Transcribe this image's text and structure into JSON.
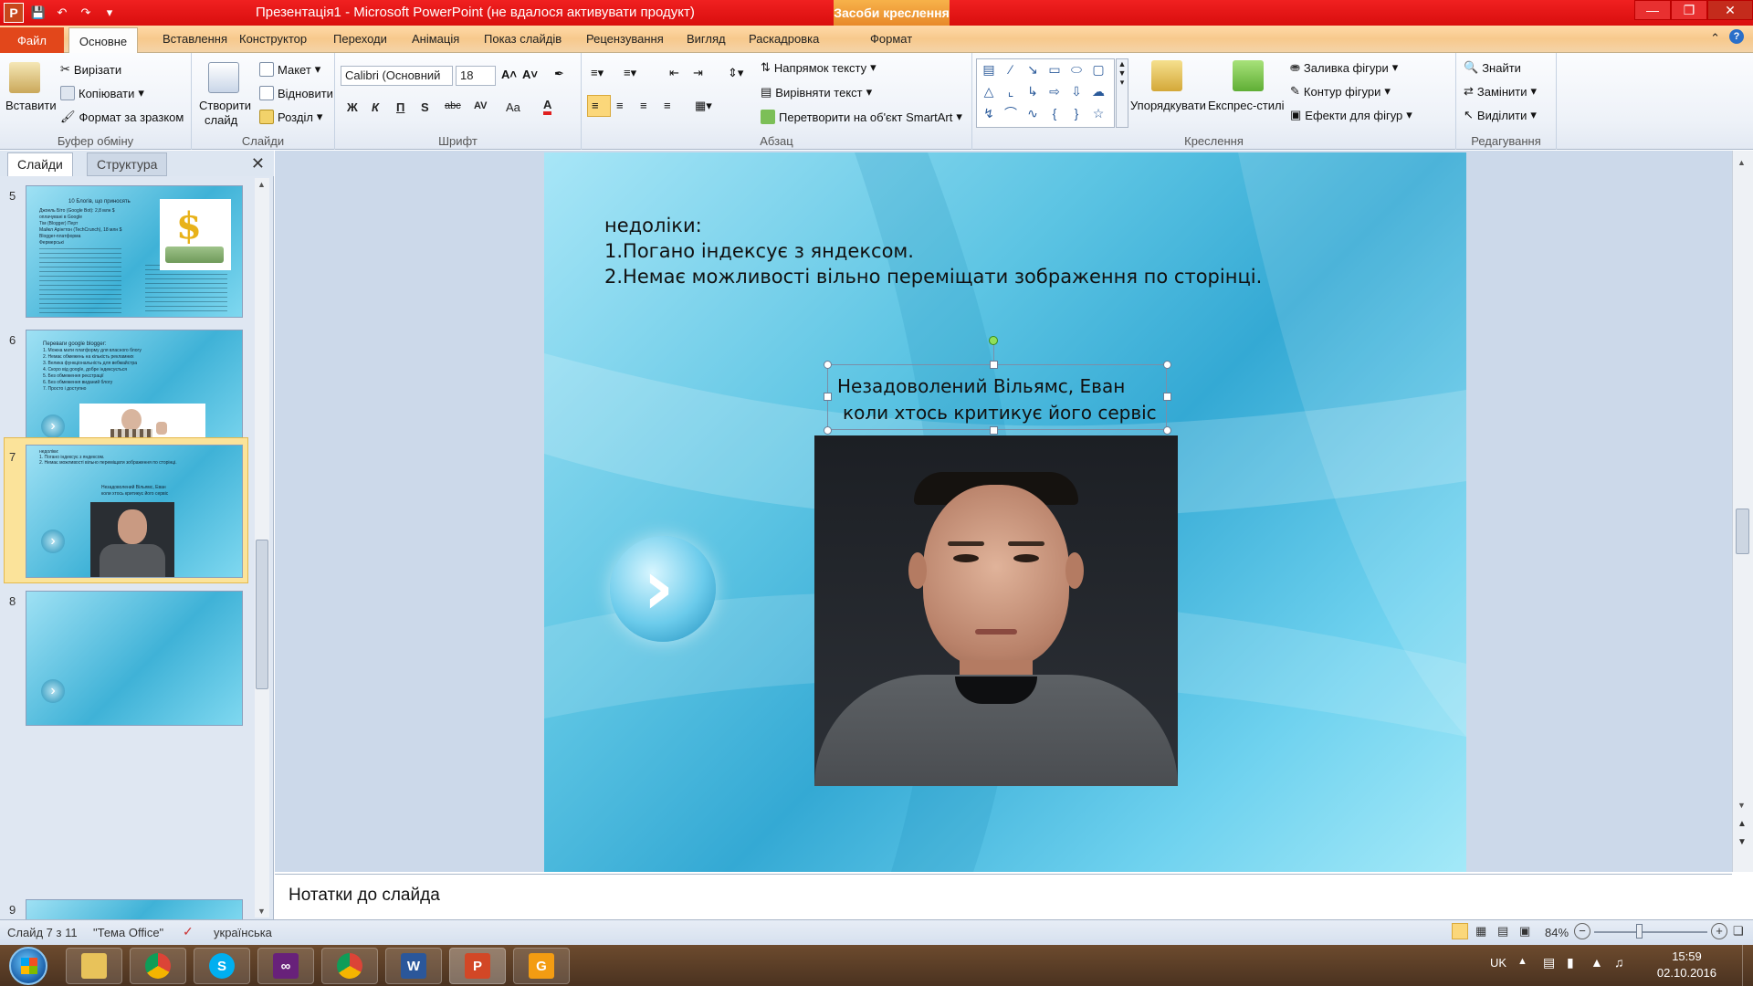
{
  "titlebar": {
    "title": "Презентація1 - Microsoft PowerPoint (не вдалося активувати продукт)",
    "contextual_tab": "Засоби креслення",
    "app_icon": "P"
  },
  "tabs": {
    "file": "Файл",
    "items": [
      "Основне",
      "Вставлення",
      "Конструктор",
      "Переходи",
      "Анімація",
      "Показ слайдів",
      "Рецензування",
      "Вигляд",
      "Раскадровка",
      "Формат"
    ]
  },
  "ribbon": {
    "clipboard": {
      "paste": "Вставити",
      "cut": "Вирізати",
      "copy": "Копіювати",
      "format_painter": "Формат за зразком",
      "label": "Буфер обміну"
    },
    "slides": {
      "new_slide_1": "Створити",
      "new_slide_2": "слайд",
      "layout": "Макет",
      "reset": "Відновити",
      "section": "Розділ",
      "label": "Слайди"
    },
    "font": {
      "name": "Calibri (Основний",
      "size": "18",
      "label": "Шрифт",
      "bold": "Ж",
      "italic": "К",
      "underline": "П",
      "shadow": "S",
      "strike": "abc",
      "spacing": "AV",
      "case": "Aa",
      "color": "A"
    },
    "paragraph": {
      "text_direction": "Напрямок тексту",
      "align_text": "Вирівняти текст",
      "smartart": "Перетворити на об'єкт SmartArt",
      "label": "Абзац"
    },
    "drawing": {
      "arrange": "Упорядкувати",
      "quick_styles": "Експрес-стилі",
      "fill": "Заливка фігури",
      "outline": "Контур фігури",
      "effects": "Ефекти для фігур",
      "label": "Креслення"
    },
    "editing": {
      "find": "Знайти",
      "replace": "Замінити",
      "select": "Виділити",
      "label": "Редагування"
    }
  },
  "panel": {
    "tab_slides": "Слайди",
    "tab_outline": "Структура",
    "thumbs": [
      {
        "num": "5",
        "title": "10 Блогів, що приносять",
        "lines": [
          "Джоель Біто (Google Bot): 2,8 млн $",
          "оплачувані в Google",
          "Тім (Blogger) Перт",
          "Майкл Арінгтон (TechCrunch), 18 млн $",
          "Blogger-платформа",
          "Фермерські"
        ]
      },
      {
        "num": "6",
        "title": "Переваги google blogger:",
        "lines": [
          "1. Можна мати платформу для власного блогу",
          "2. Немає обмежень на кількість рекламних",
          "3. Велика функціональність для вебмайстра",
          "4. Скоро від google, добре індексується",
          "5. Без обмеження реєстрації",
          "6. Без обмеження виданий блогу",
          "7. Просто і доступно"
        ]
      },
      {
        "num": "7",
        "title": "недоліки:",
        "lines": [
          "1. Погано індексує з яндексом.",
          "2. Немає можливості вільно переміщати зображення по сторінці."
        ],
        "caption1": "Незадоволений Вільямс, Еван",
        "caption2": "коли хтось критикує його сервіс"
      },
      {
        "num": "8"
      },
      {
        "num": "9"
      }
    ]
  },
  "slide": {
    "heading": "недоліки:",
    "line1": "1.Погано індексує з яндексом.",
    "line2": "2.Немає можливості вільно переміщати зображення по сторінці.",
    "caption_line1": "Незадоволений Вільямс, Еван",
    "caption_line2": "коли хтось критикує його сервіс"
  },
  "notes": {
    "placeholder": "Нотатки до слайда"
  },
  "status": {
    "slide_counter": "Слайд 7 з 11",
    "theme": "\"Тема Office\"",
    "language": "українська",
    "zoom": "84%"
  },
  "taskbar": {
    "lang": "UK",
    "time": "15:59",
    "date": "02.10.2016"
  }
}
